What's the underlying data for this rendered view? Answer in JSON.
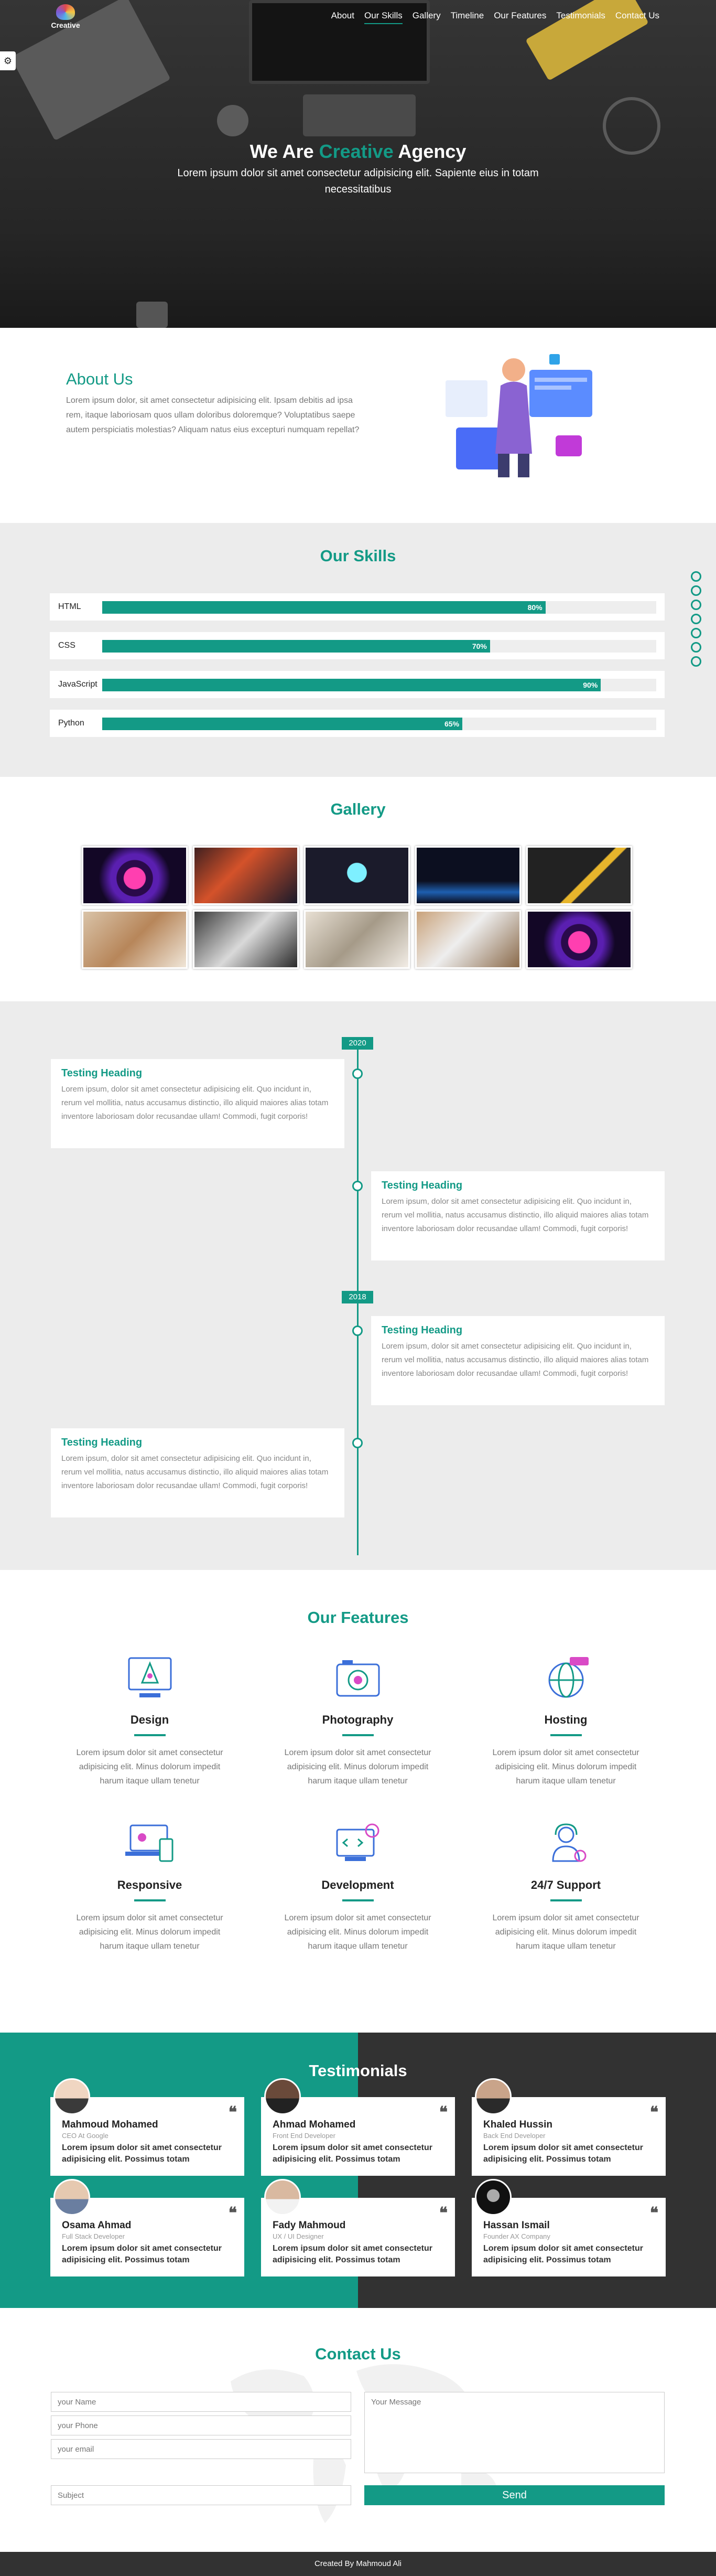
{
  "logo": {
    "text": "Creative"
  },
  "nav": {
    "items": [
      "About",
      "Our Skills",
      "Gallery",
      "Timeline",
      "Our Features",
      "Testimonials",
      "Contact Us"
    ],
    "active_index": 1
  },
  "hero": {
    "title_pre": "We Are",
    "title_highlight": "Creative",
    "title_post": "Agency",
    "subtitle": "Lorem ipsum dolor sit amet consectetur adipisicing elit. Sapiente eius in totam necessitatibus"
  },
  "about": {
    "title": "About Us",
    "text": "Lorem ipsum dolor, sit amet consectetur adipisicing elit. Ipsam debitis ad ipsa rem, itaque laboriosam quos ullam doloribus doloremque? Voluptatibus saepe autem perspiciatis molestias? Aliquam natus eius excepturi numquam repellat?"
  },
  "skills": {
    "title": "Our Skills",
    "items": [
      {
        "name": "HTML",
        "percent": "80%",
        "value": 0.8
      },
      {
        "name": "CSS",
        "percent": "70%",
        "value": 0.7
      },
      {
        "name": "JavaScript",
        "percent": "90%",
        "value": 0.9
      },
      {
        "name": "Python",
        "percent": "65%",
        "value": 0.65
      }
    ]
  },
  "gallery": {
    "title": "Gallery"
  },
  "timeline": {
    "years": [
      "2020",
      "2018"
    ],
    "items": [
      {
        "heading": "Testing Heading",
        "text": "Lorem ipsum, dolor sit amet consectetur adipisicing elit. Quo incidunt in, rerum vel mollitia, natus accusamus distinctio, illo aliquid maiores alias totam inventore laboriosam dolor recusandae ullam! Commodi, fugit corporis!"
      },
      {
        "heading": "Testing Heading",
        "text": "Lorem ipsum, dolor sit amet consectetur adipisicing elit. Quo incidunt in, rerum vel mollitia, natus accusamus distinctio, illo aliquid maiores alias totam inventore laboriosam dolor recusandae ullam! Commodi, fugit corporis!"
      },
      {
        "heading": "Testing Heading",
        "text": "Lorem ipsum, dolor sit amet consectetur adipisicing elit. Quo incidunt in, rerum vel mollitia, natus accusamus distinctio, illo aliquid maiores alias totam inventore laboriosam dolor recusandae ullam! Commodi, fugit corporis!"
      },
      {
        "heading": "Testing Heading",
        "text": "Lorem ipsum, dolor sit amet consectetur adipisicing elit. Quo incidunt in, rerum vel mollitia, natus accusamus distinctio, illo aliquid maiores alias totam inventore laboriosam dolor recusandae ullam! Commodi, fugit corporis!"
      }
    ]
  },
  "features": {
    "title": "Our Features",
    "text": "Lorem ipsum dolor sit amet consectetur adipisicing elit. Minus dolorum impedit harum itaque ullam tenetur",
    "items": [
      {
        "name": "Design",
        "icon": "design-icon"
      },
      {
        "name": "Photography",
        "icon": "camera-icon"
      },
      {
        "name": "Hosting",
        "icon": "globe-icon"
      },
      {
        "name": "Responsive",
        "icon": "devices-icon"
      },
      {
        "name": "Development",
        "icon": "code-icon"
      },
      {
        "name": "24/7 Support",
        "icon": "support-icon"
      }
    ]
  },
  "testimonials": {
    "title": "Testimonials",
    "text": "Lorem ipsum dolor sit amet consectetur adipisicing elit. Possimus totam",
    "people": [
      {
        "name": "Mahmoud Mohamed",
        "role": "CEO At Google"
      },
      {
        "name": "Ahmad Mohamed",
        "role": "Front End Developer"
      },
      {
        "name": "Khaled Hussin",
        "role": "Back End Developer"
      },
      {
        "name": "Osama Ahmad",
        "role": "Full Stack Developer"
      },
      {
        "name": "Fady Mahmoud",
        "role": "UX / UI Designer"
      },
      {
        "name": "Hassan Ismail",
        "role": "Founder AX Company"
      }
    ]
  },
  "contact": {
    "title": "Contact Us",
    "name_ph": "your Name",
    "phone_ph": "your Phone",
    "email_ph": "your email",
    "subject_ph": "Subject",
    "message_ph": "Your Message",
    "send": "Send"
  },
  "footer": {
    "text": "Created By Mahmoud Ali"
  },
  "colors": {
    "accent": "#139a86",
    "dark": "#323232"
  }
}
